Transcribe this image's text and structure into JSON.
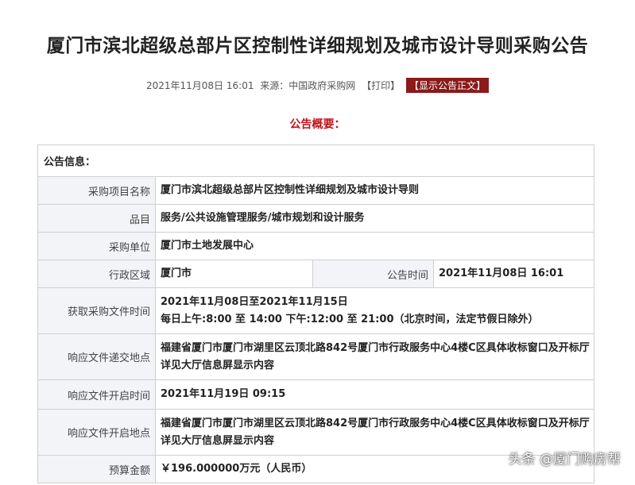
{
  "title": "厦门市滨北超级总部片区控制性详细规划及城市设计导则采购公告",
  "meta": {
    "datetime": "2021年11月08日 16:01",
    "source": "来源：中国政府采购网",
    "print": "【打印】",
    "show_text": "【显示公告正文】"
  },
  "overview_heading": "公告概要：",
  "info": {
    "section": "公告信息：",
    "project_name_label": "采购项目名称",
    "project_name": "厦门市滨北超级总部片区控制性详细规划及城市设计导则",
    "category_label": "品目",
    "category": "服务/公共设施管理服务/城市规划和设计服务",
    "purchaser_label": "采购单位",
    "purchaser": "厦门市土地发展中心",
    "region_label": "行政区域",
    "region": "厦门市",
    "announce_time_label": "公告时间",
    "announce_time": "2021年11月08日  16:01",
    "obtain_time_label": "获取采购文件时间",
    "obtain_time_line1": "2021年11月08日至2021年11月15日",
    "obtain_time_line2": "每日上午:8:00 至 14:00  下午:12:00 至 21:00（北京时间，法定节假日除外）",
    "submit_place_label": "响应文件递交地点",
    "submit_place": "福建省厦门市厦门市湖里区云顶北路842号厦门市行政服务中心4楼C区具体收标窗口及开标厅详见大厅信息屏显示内容",
    "open_time_label": "响应文件开启时间",
    "open_time": "2021年11月19日  09:15",
    "open_place_label": "响应文件开启地点",
    "open_place": "福建省厦门市厦门市湖里区云顶北路842号厦门市行政服务中心4楼C区具体收标窗口及开标厅详见大厅信息屏显示内容",
    "budget_label": "预算金额",
    "budget": "￥196.000000万元（人民币）"
  },
  "watermark": "头条 @厦门购房帮"
}
